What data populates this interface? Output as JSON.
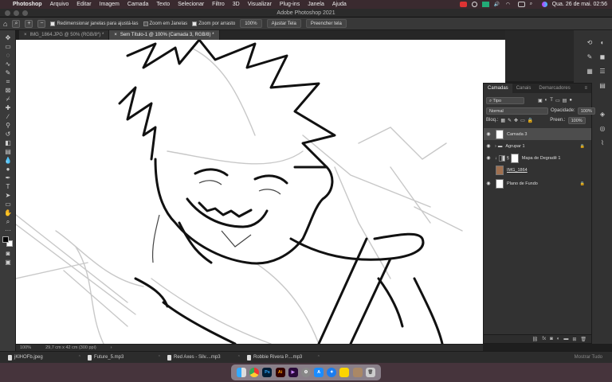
{
  "menubar": {
    "app": "Photoshop",
    "items": [
      "Arquivo",
      "Editar",
      "Imagem",
      "Camada",
      "Texto",
      "Selecionar",
      "Filtro",
      "3D",
      "Visualizar",
      "Plug-ins",
      "Janela",
      "Ajuda"
    ],
    "datetime": "Qua. 26 de mai.  02:56"
  },
  "window_title": "Adobe Photoshop 2021",
  "options": {
    "resize_windows": "Redimensionar janelas para ajustá-las",
    "zoom_all_windows": "Zoom em Janelas",
    "scrubby_zoom": "Zoom por arrasto",
    "zoom_value": "100%",
    "fit_screen": "Ajustar Tela",
    "fill_screen": "Preencher tela"
  },
  "tabs": [
    {
      "label": "IMG_1864.JPG @ 50% (RGB/8*) *",
      "close": "×"
    },
    {
      "label": "Sem Título-1 @ 100% (Camada 3, RGB/8) *",
      "close": "×"
    }
  ],
  "layers_panel": {
    "tabs": [
      "Camadas",
      "Canais",
      "Demarcadores"
    ],
    "filter_kind": "Tipo",
    "blend_mode": "Normal",
    "opacity_label": "Opacidade:",
    "opacity_value": "100%",
    "lock_label": "Bloq.:",
    "fill_label": "Preen.:",
    "fill_value": "100%",
    "layers": [
      {
        "name": "Camada 3",
        "selected": true
      },
      {
        "name": "Agrupar 1",
        "selected": false
      },
      {
        "name": "Mapa de Degradê 1",
        "selected": false
      },
      {
        "name": "IMG_1864",
        "selected": false
      },
      {
        "name": "Plano de Fundo",
        "selected": false
      }
    ]
  },
  "status": {
    "zoom": "100%",
    "doc_size": "29,7 cm x 42 cm (300 ppi)"
  },
  "downloads": {
    "items": [
      "jKlHOFb.jpeg",
      "Future_5.mp3",
      "Red Axes - Silv....mp3",
      "Robbie Rivera P....mp3"
    ],
    "show_all": "Mostrar Tudo"
  },
  "dock_apps": [
    "Finder",
    "Chrome",
    "Ps",
    "Ai",
    "Premiere",
    "Settings",
    "App Store",
    "Safari",
    "Notes",
    "Preview",
    "Trash"
  ]
}
